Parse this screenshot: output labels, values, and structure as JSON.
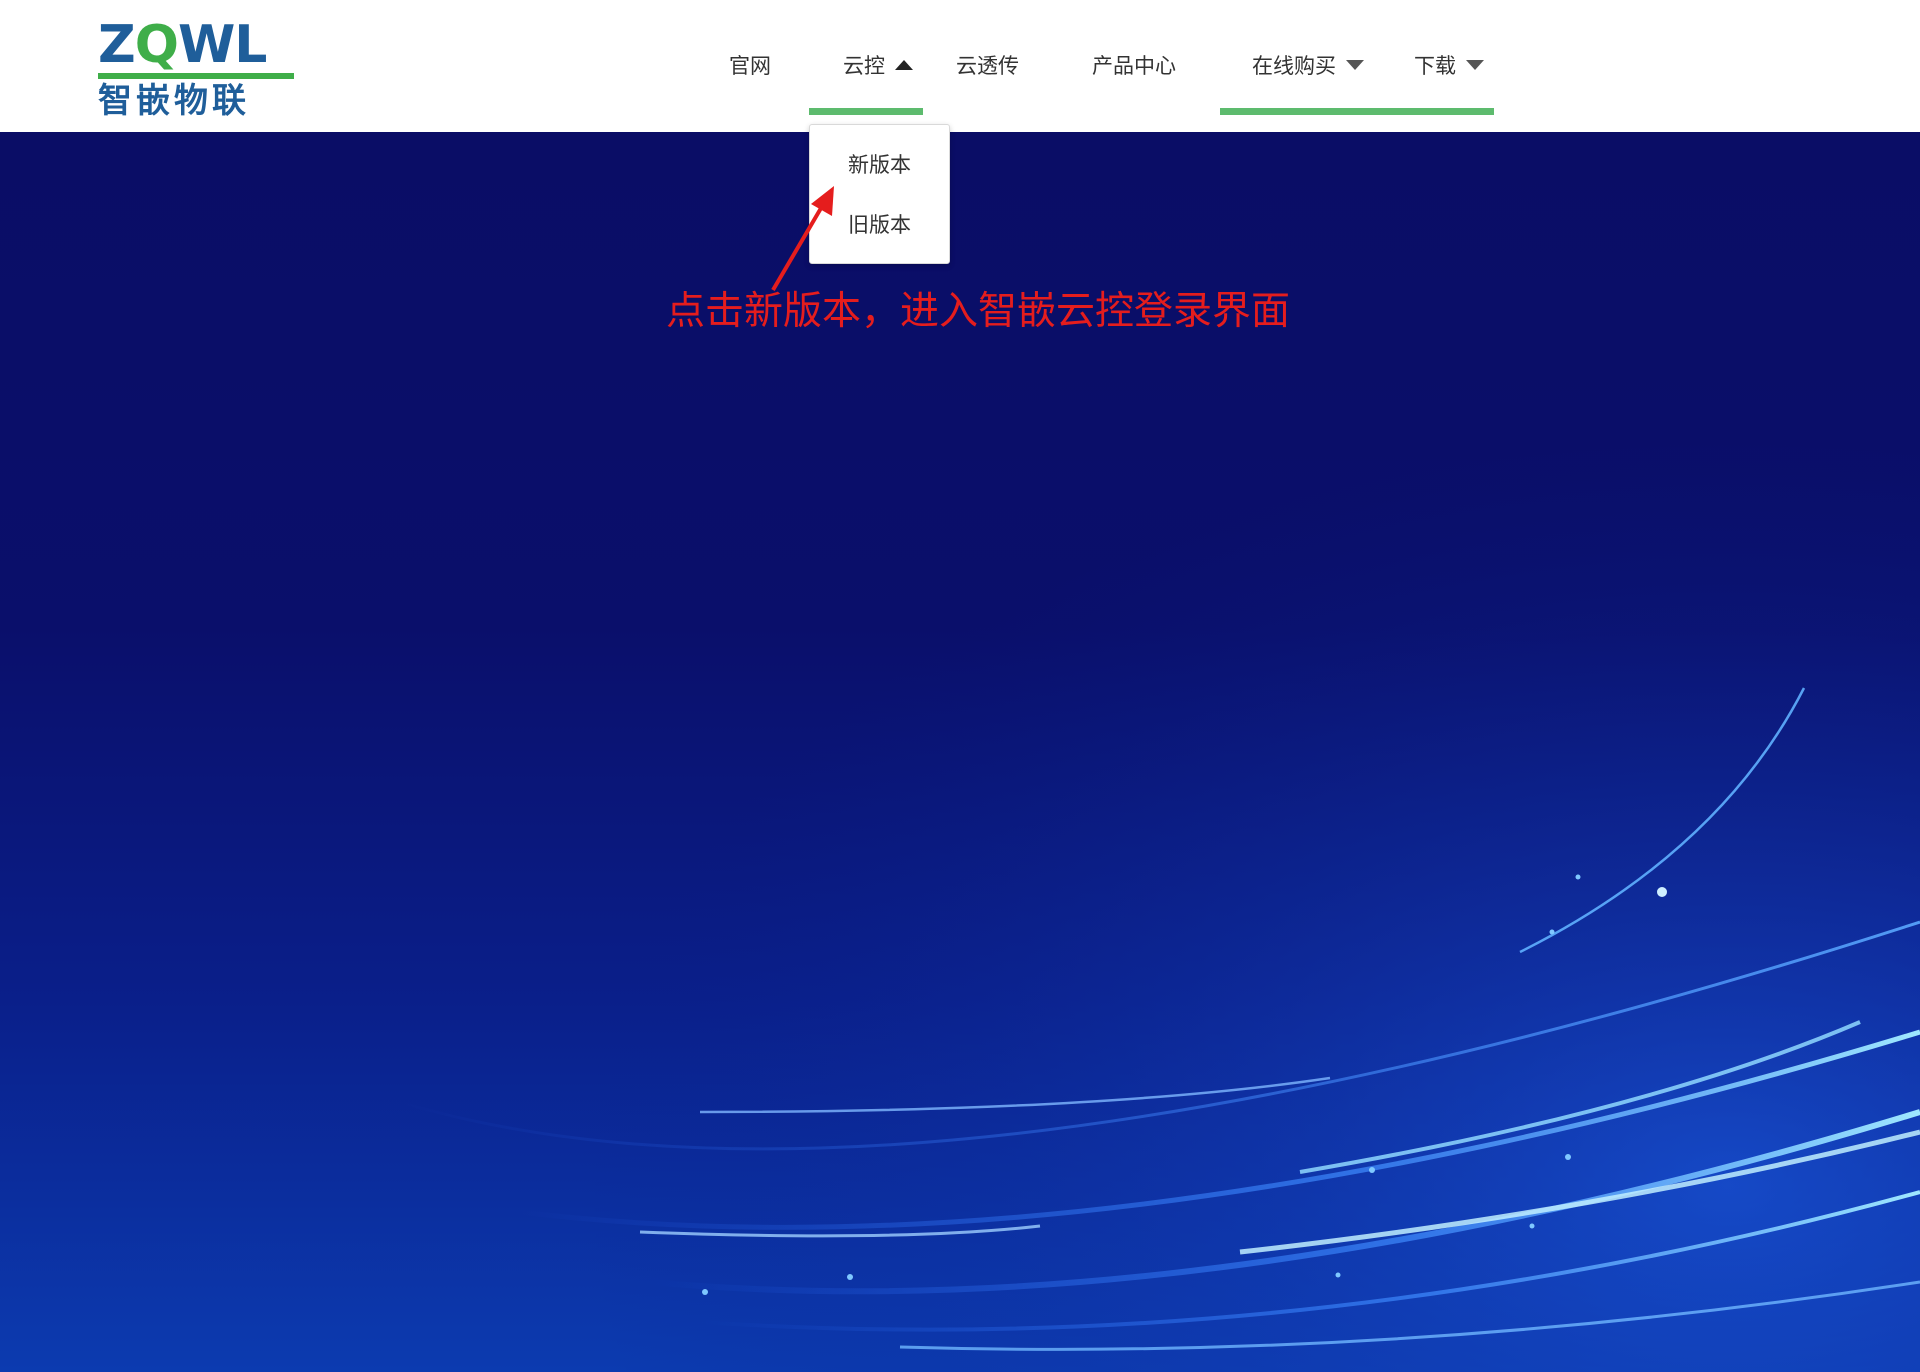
{
  "header": {
    "logo": {
      "wordmark_part1": "Z",
      "wordmark_part2": "Q",
      "wordmark_part3": "WL",
      "chinese_name": "智嵌物联"
    },
    "nav": {
      "item_official": "官网",
      "item_cloud_control": "云控",
      "item_cloud_transparent": "云透传",
      "item_product_center": "产品中心",
      "item_online_purchase": "在线购买",
      "item_download": "下载"
    },
    "cloud_control_dropdown": {
      "expanded": true,
      "item_new_version": "新版本",
      "item_old_version": "旧版本"
    }
  },
  "annotation": {
    "text": "点击新版本，进入智嵌云控登录界面"
  },
  "colors": {
    "brand_blue": "#1f5e9a",
    "brand_green": "#3fae49",
    "nav_underline": "#5dbb6e",
    "annotation_red": "#e51d1d",
    "hero_dark": "#0a0d66",
    "hero_bright": "#0c3bb0"
  },
  "icons": {
    "cloud_control_caret": "caret-up-icon",
    "online_purchase_caret": "caret-down-icon",
    "download_caret": "caret-down-icon",
    "annotation_arrow": "arrow-icon"
  }
}
